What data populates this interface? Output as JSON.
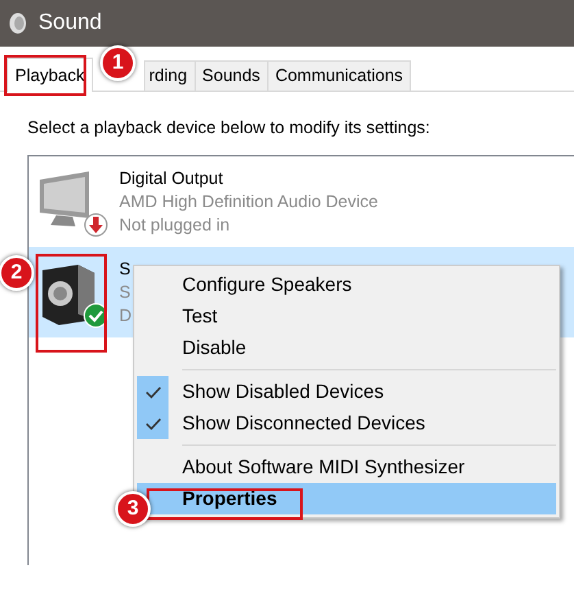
{
  "window": {
    "title": "Sound"
  },
  "tabs": [
    {
      "label": "Playback",
      "selected": true
    },
    {
      "label": "rding",
      "selected": false
    },
    {
      "label": "Sounds",
      "selected": false
    },
    {
      "label": "Communications",
      "selected": false
    }
  ],
  "instruction": "Select a playback device below to modify its settings:",
  "devices": [
    {
      "kind": "monitor",
      "default": false,
      "name": "Digital Output",
      "driver": "AMD High Definition Audio Device",
      "status": "Not plugged in",
      "selected": false
    },
    {
      "kind": "speaker",
      "default": true,
      "name": "S",
      "driver": "S",
      "status": "D",
      "selected": true
    }
  ],
  "context_menu": {
    "items": [
      {
        "kind": "item",
        "label": "Configure Speakers",
        "checked": false,
        "selected": false,
        "bold": false
      },
      {
        "kind": "item",
        "label": "Test",
        "checked": false,
        "selected": false,
        "bold": false
      },
      {
        "kind": "item",
        "label": "Disable",
        "checked": false,
        "selected": false,
        "bold": false
      },
      {
        "kind": "separator"
      },
      {
        "kind": "item",
        "label": "Show Disabled Devices",
        "checked": true,
        "selected": false,
        "bold": false
      },
      {
        "kind": "item",
        "label": "Show Disconnected Devices",
        "checked": true,
        "selected": false,
        "bold": false
      },
      {
        "kind": "separator"
      },
      {
        "kind": "item",
        "label": "About Software MIDI Synthesizer",
        "checked": false,
        "selected": false,
        "bold": false
      },
      {
        "kind": "item",
        "label": "Properties",
        "checked": false,
        "selected": true,
        "bold": true
      }
    ]
  },
  "annotations": [
    {
      "number": "1"
    },
    {
      "number": "2"
    },
    {
      "number": "3"
    }
  ]
}
